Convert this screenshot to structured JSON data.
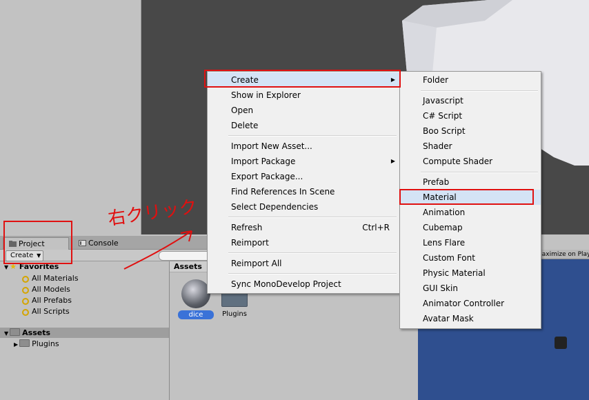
{
  "project_panel": {
    "tabs": [
      {
        "label": "Project",
        "icon": "folder-icon"
      },
      {
        "label": "Console",
        "icon": "console-icon"
      }
    ],
    "create_label": "Create",
    "favorites": {
      "title": "Favorites",
      "items": [
        "All Materials",
        "All Models",
        "All Prefabs",
        "All Scripts"
      ]
    },
    "assets": {
      "title": "Assets",
      "children": [
        "Plugins"
      ]
    },
    "assets_view": {
      "label": "Assets",
      "items": [
        {
          "name": "dice",
          "icon": "material-sphere-icon"
        },
        {
          "name": "Plugins",
          "icon": "folder-icon"
        }
      ]
    }
  },
  "game_view": {
    "maximize_label": "Maximize on Play"
  },
  "context_menu": {
    "items": [
      {
        "label": "Create",
        "submenu": true
      },
      {
        "label": "Show in Explorer"
      },
      {
        "label": "Open"
      },
      {
        "label": "Delete"
      },
      {
        "label": "Import New Asset..."
      },
      {
        "label": "Import Package",
        "submenu": true
      },
      {
        "label": "Export Package..."
      },
      {
        "label": "Find References In Scene"
      },
      {
        "label": "Select Dependencies"
      },
      {
        "label": "Refresh",
        "shortcut": "Ctrl+R"
      },
      {
        "label": "Reimport"
      },
      {
        "label": "Reimport All"
      },
      {
        "label": "Sync MonoDevelop Project"
      }
    ]
  },
  "create_submenu": {
    "items": [
      "Folder",
      "Javascript",
      "C# Script",
      "Boo Script",
      "Shader",
      "Compute Shader",
      "Prefab",
      "Material",
      "Animation",
      "Cubemap",
      "Lens Flare",
      "Custom Font",
      "Physic Material",
      "GUI Skin",
      "Animator Controller",
      "Avatar Mask"
    ],
    "highlighted": "Material"
  },
  "annotation": {
    "text": "右クリック",
    "color": "#e01010"
  }
}
